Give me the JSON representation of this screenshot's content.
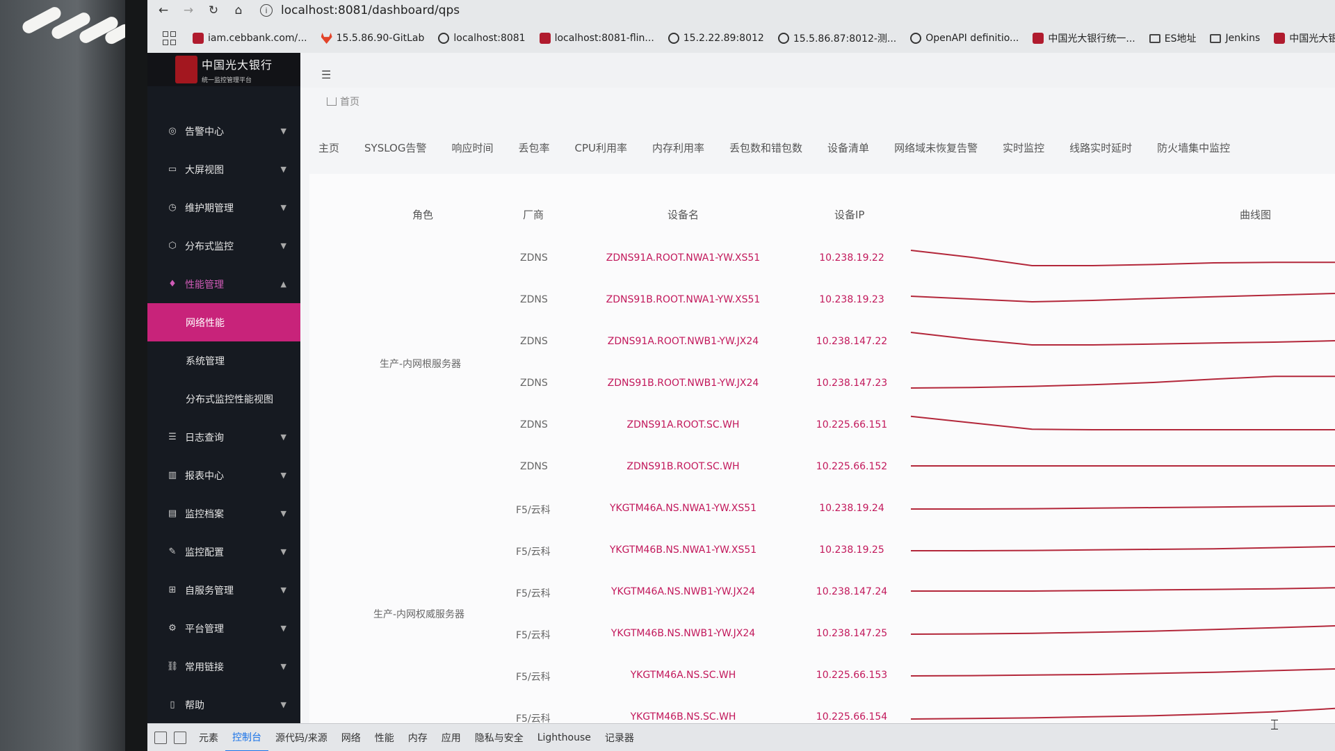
{
  "browser": {
    "url": "localhost:8081/dashboard/qps",
    "bookmarks": [
      {
        "label": "iam.cebbank.com/...",
        "icon": "red"
      },
      {
        "label": "15.5.86.90-GitLab",
        "icon": "gitlab"
      },
      {
        "label": "localhost:8081",
        "icon": "globe"
      },
      {
        "label": "localhost:8081-flin...",
        "icon": "red"
      },
      {
        "label": "15.2.22.89:8012",
        "icon": "globe"
      },
      {
        "label": "15.5.86.87:8012-测...",
        "icon": "globe"
      },
      {
        "label": "OpenAPI definitio...",
        "icon": "globe"
      },
      {
        "label": "中国光大银行统一...",
        "icon": "red"
      },
      {
        "label": "ES地址",
        "icon": "folder"
      },
      {
        "label": "Jenkins",
        "icon": "folder"
      },
      {
        "label": "中国光大银行统...",
        "icon": "red"
      }
    ]
  },
  "app": {
    "logo_title": "中国光大银行",
    "logo_subtitle": "统一监控管理平台",
    "breadcrumb": "首页"
  },
  "menu": [
    {
      "label": "告警中心",
      "icon": "◎"
    },
    {
      "label": "大屏视图",
      "icon": "▭"
    },
    {
      "label": "维护期管理",
      "icon": "◷"
    },
    {
      "label": "分布式监控",
      "icon": "⬡"
    },
    {
      "label": "性能管理",
      "icon": "♦",
      "open": true
    },
    {
      "label": "日志查询",
      "icon": "☰"
    },
    {
      "label": "报表中心",
      "icon": "▥"
    },
    {
      "label": "监控档案",
      "icon": "▤"
    },
    {
      "label": "监控配置",
      "icon": "✎"
    },
    {
      "label": "自服务管理",
      "icon": "⊞"
    },
    {
      "label": "平台管理",
      "icon": "⚙"
    },
    {
      "label": "常用链接",
      "icon": "⛓"
    },
    {
      "label": "帮助",
      "icon": "▯"
    }
  ],
  "submenu": [
    "网络性能",
    "系统管理",
    "分布式监控性能视图"
  ],
  "tabs": [
    "主页",
    "SYSLOG告警",
    "响应时间",
    "丢包率",
    "CPU利用率",
    "内存利用率",
    "丢包数和错包数",
    "设备清单",
    "网络域未恢复告警",
    "实时监控",
    "线路实时延时",
    "防火墙集中监控"
  ],
  "table": {
    "headers": {
      "role": "角色",
      "vendor": "厂商",
      "name": "设备名",
      "ip": "设备IP",
      "chart": "曲线图"
    },
    "groups": [
      {
        "role": "生产-内网根服务器",
        "rows": [
          0,
          1,
          2,
          3,
          4,
          5
        ]
      },
      {
        "role": "生产-内网权威服务器",
        "rows": [
          6,
          7,
          8,
          9,
          10,
          11
        ]
      }
    ],
    "rows": [
      {
        "vendor": "ZDNS",
        "name": "ZDNS91A.ROOT.NWA1-YW.XS51",
        "ip": "10.238.19.22",
        "trend": [
          0.75,
          0.5,
          0.2,
          0.2,
          0.24,
          0.3,
          0.32,
          0.32
        ]
      },
      {
        "vendor": "ZDNS",
        "name": "ZDNS91B.ROOT.NWA1-YW.XS51",
        "ip": "10.238.19.23",
        "trend": [
          0.6,
          0.5,
          0.4,
          0.45,
          0.52,
          0.58,
          0.64,
          0.7
        ]
      },
      {
        "vendor": "ZDNS",
        "name": "ZDNS91A.ROOT.NWB1-YW.JX24",
        "ip": "10.238.147.22",
        "trend": [
          0.8,
          0.55,
          0.35,
          0.35,
          0.38,
          0.42,
          0.45,
          0.5
        ]
      },
      {
        "vendor": "ZDNS",
        "name": "ZDNS91B.ROOT.NWB1-YW.JX24",
        "ip": "10.238.147.23",
        "trend": [
          0.3,
          0.32,
          0.36,
          0.42,
          0.5,
          0.62,
          0.72,
          0.72
        ]
      },
      {
        "vendor": "ZDNS",
        "name": "ZDNS91A.ROOT.SC.WH",
        "ip": "10.225.66.151",
        "trend": [
          0.78,
          0.55,
          0.32,
          0.3,
          0.3,
          0.3,
          0.3,
          0.3
        ]
      },
      {
        "vendor": "ZDNS",
        "name": "ZDNS91B.ROOT.SC.WH",
        "ip": "10.225.66.152",
        "trend": [
          0.5,
          0.5,
          0.5,
          0.5,
          0.5,
          0.5,
          0.5,
          0.5
        ]
      },
      {
        "vendor": "F5/云科",
        "name": "YKGTM46A.NS.NWA1-YW.XS51",
        "ip": "10.238.19.24",
        "trend": [
          0.45,
          0.45,
          0.46,
          0.48,
          0.5,
          0.52,
          0.54,
          0.56
        ]
      },
      {
        "vendor": "F5/云科",
        "name": "YKGTM46B.NS.NWA1-YW.XS51",
        "ip": "10.238.19.25",
        "trend": [
          0.45,
          0.45,
          0.46,
          0.48,
          0.5,
          0.52,
          0.56,
          0.6
        ]
      },
      {
        "vendor": "F5/云科",
        "name": "YKGTM46A.NS.NWB1-YW.JX24",
        "ip": "10.238.147.24",
        "trend": [
          0.5,
          0.5,
          0.5,
          0.52,
          0.54,
          0.56,
          0.58,
          0.62
        ]
      },
      {
        "vendor": "F5/云科",
        "name": "YKGTM46B.NS.NWB1-YW.JX24",
        "ip": "10.238.147.25",
        "trend": [
          0.45,
          0.46,
          0.48,
          0.52,
          0.56,
          0.62,
          0.68,
          0.75
        ]
      },
      {
        "vendor": "F5/云科",
        "name": "YKGTM46A.NS.SC.WH",
        "ip": "10.225.66.153",
        "trend": [
          0.45,
          0.46,
          0.48,
          0.5,
          0.54,
          0.58,
          0.64,
          0.7
        ]
      },
      {
        "vendor": "F5/云科",
        "name": "YKGTM46B.NS.SC.WH",
        "ip": "10.225.66.154",
        "trend": [
          0.4,
          0.42,
          0.44,
          0.48,
          0.52,
          0.58,
          0.66,
          0.78
        ]
      }
    ]
  },
  "devtools": {
    "tabs": [
      "元素",
      "控制台",
      "源代码/来源",
      "网络",
      "性能",
      "内存",
      "应用",
      "隐私与安全",
      "Lighthouse",
      "记录器"
    ],
    "active": "控制台"
  },
  "colors": {
    "accent": "#c8237a",
    "link": "#c2185b",
    "trend": "#b3273a",
    "sidebar": "#161a21"
  }
}
